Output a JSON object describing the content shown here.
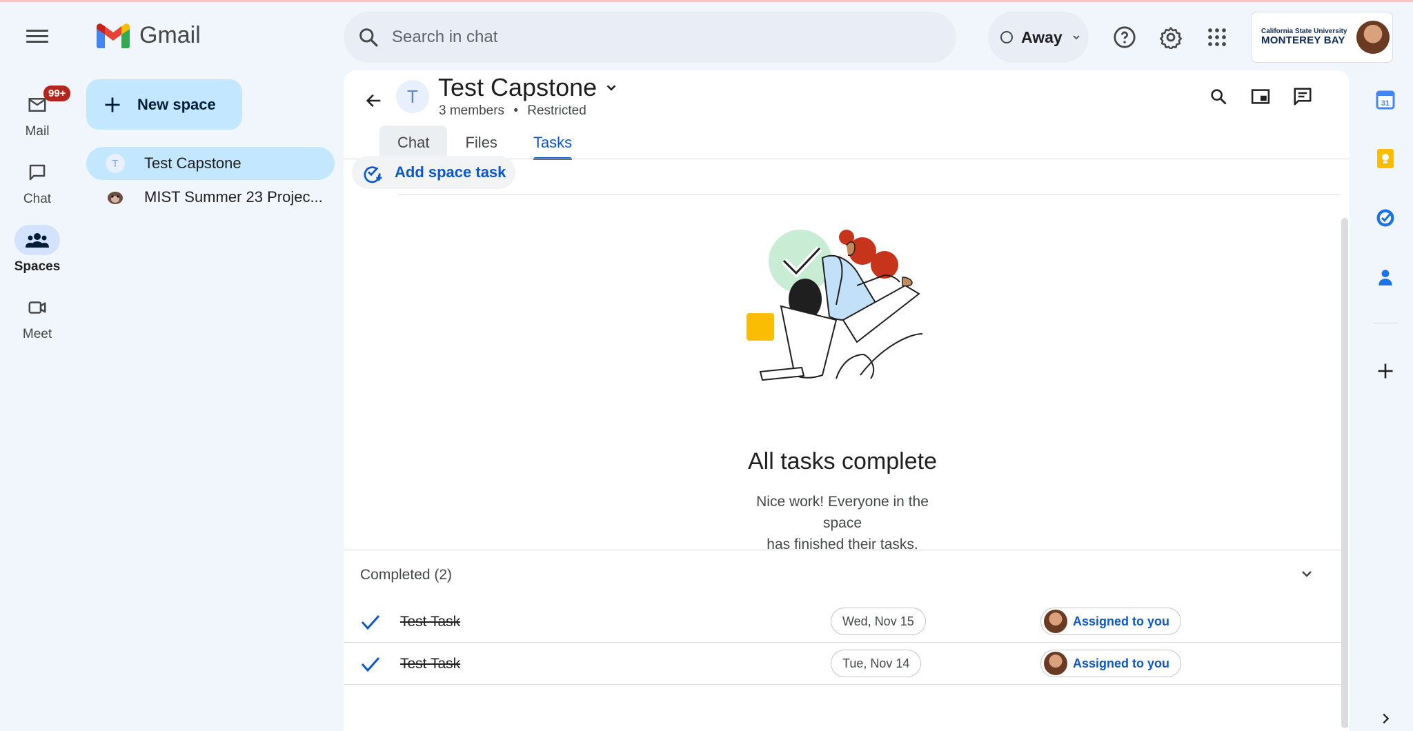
{
  "rail": {
    "mail_label": "Mail",
    "mail_badge": "99+",
    "chat_label": "Chat",
    "spaces_label": "Spaces",
    "meet_label": "Meet"
  },
  "app": {
    "logo_text": "Gmail"
  },
  "nav": {
    "new_space_label": "New space",
    "spaces": [
      {
        "label": "Test Capstone",
        "initial": "T"
      },
      {
        "label": "MIST Summer 23 Projec..."
      }
    ]
  },
  "search": {
    "placeholder": "Search in chat"
  },
  "status": {
    "label": "Away"
  },
  "org": {
    "line1": "California State University",
    "line2": "MONTEREY BAY"
  },
  "space": {
    "initial": "T",
    "title": "Test Capstone",
    "members": "3 members",
    "separator": "•",
    "access": "Restricted"
  },
  "tabs": [
    {
      "label": "Chat"
    },
    {
      "label": "Files"
    },
    {
      "label": "Tasks"
    }
  ],
  "tasks": {
    "add_label": "Add space task",
    "empty_title": "All tasks complete",
    "empty_line1": "Nice work! Everyone in the space",
    "empty_line2": "has finished their tasks.",
    "completed_header": "Completed (2)",
    "items": [
      {
        "title": "Test Task",
        "date": "Wed, Nov 15",
        "assignee": "Assigned to you"
      },
      {
        "title": "Test Task",
        "date": "Tue, Nov 14",
        "assignee": "Assigned to you"
      }
    ]
  },
  "right_rail": {
    "calendar_day": "31",
    "icons": [
      "calendar-icon",
      "keep-icon",
      "tasks-icon",
      "contacts-icon",
      "add-icon",
      "chevron-right-icon"
    ]
  },
  "colors": {
    "accent": "#0b57d0",
    "selection": "#c2e7ff",
    "badge": "#b3261e",
    "background": "#f1f5fc"
  }
}
